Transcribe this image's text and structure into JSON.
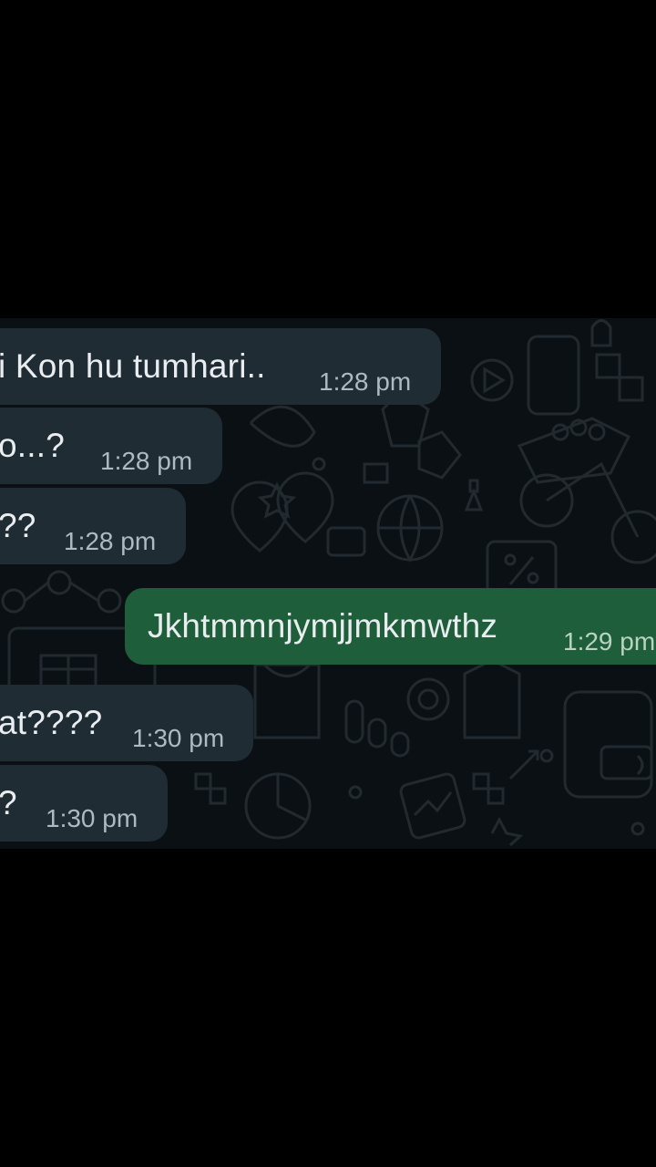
{
  "messages": [
    {
      "direction": "incoming",
      "text": "i Kon hu tumhari..",
      "time": "1:28 pm"
    },
    {
      "direction": "incoming",
      "text": "o...?",
      "time": "1:28 pm"
    },
    {
      "direction": "incoming",
      "text": "??",
      "time": "1:28 pm"
    },
    {
      "direction": "outgoing",
      "text": "Jkhtmmnjymjjmkmwthz",
      "time": "1:29 pm"
    },
    {
      "direction": "incoming",
      "text": "at????",
      "time": "1:30 pm"
    },
    {
      "direction": "incoming",
      "text": "?",
      "time": "1:30 pm"
    }
  ],
  "colors": {
    "background": "#000000",
    "chat_background": "#0b1014",
    "incoming_bubble": "#1f2c33",
    "outgoing_bubble": "#1f5e3b",
    "text": "#e9edef",
    "timestamp": "#aebac1"
  }
}
